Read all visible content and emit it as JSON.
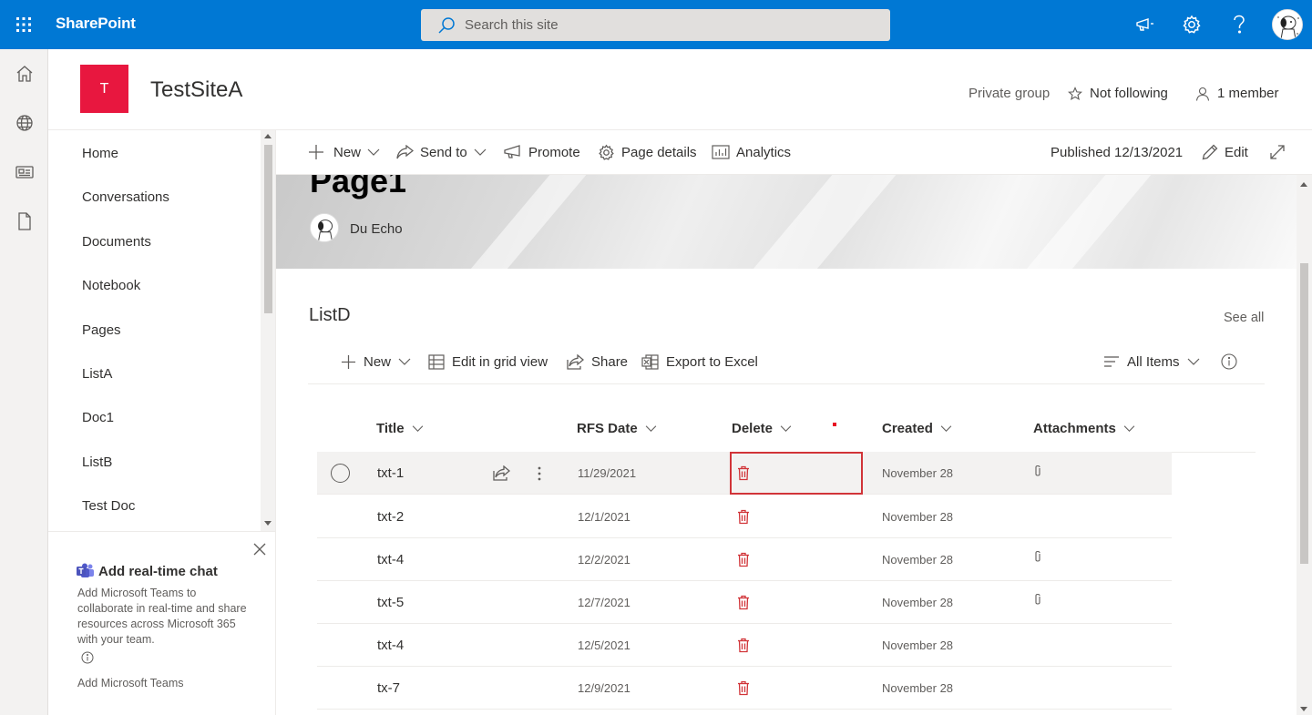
{
  "suitebar": {
    "brand": "SharePoint",
    "search_placeholder": "Search this site"
  },
  "site": {
    "logo_letter": "T",
    "title": "TestSiteA",
    "privacy": "Private group",
    "follow": "Not following",
    "members": "1 member"
  },
  "nav": {
    "items": [
      "Home",
      "Conversations",
      "Documents",
      "Notebook",
      "Pages",
      "ListA",
      "Doc1",
      "ListB",
      "Test Doc"
    ]
  },
  "promo": {
    "title": "Add real-time chat",
    "body": "Add Microsoft Teams to collaborate in real-time and share resources across Microsoft 365 with your team.",
    "link": "Add Microsoft Teams"
  },
  "commandbar": {
    "new": "New",
    "send_to": "Send to",
    "promote": "Promote",
    "page_details": "Page details",
    "analytics": "Analytics",
    "published": "Published 12/13/2021",
    "edit": "Edit"
  },
  "page": {
    "title": "Page1",
    "author": "Du Echo"
  },
  "list": {
    "title": "ListD",
    "see_all": "See all",
    "commands": {
      "new": "New",
      "edit_grid": "Edit in grid view",
      "share": "Share",
      "export": "Export to Excel",
      "view": "All Items"
    },
    "columns": {
      "title": "Title",
      "rfs_date": "RFS Date",
      "delete": "Delete",
      "created": "Created",
      "attachments": "Attachments"
    },
    "rows": [
      {
        "title": "txt-1",
        "rfs_date": "11/29/2021",
        "created": "November 28",
        "attachment": true
      },
      {
        "title": "txt-2",
        "rfs_date": "12/1/2021",
        "created": "November 28",
        "attachment": false
      },
      {
        "title": "txt-4",
        "rfs_date": "12/2/2021",
        "created": "November 28",
        "attachment": true
      },
      {
        "title": "txt-5",
        "rfs_date": "12/7/2021",
        "created": "November 28",
        "attachment": true
      },
      {
        "title": "txt-4",
        "rfs_date": "12/5/2021",
        "created": "November 28",
        "attachment": false
      },
      {
        "title": "tx-7",
        "rfs_date": "12/9/2021",
        "created": "November 28",
        "attachment": false
      }
    ]
  },
  "colors": {
    "brand_blue": "#0078d4",
    "site_logo": "#e8173f",
    "delete_icon": "#d13438",
    "highlight": "#d13438"
  }
}
